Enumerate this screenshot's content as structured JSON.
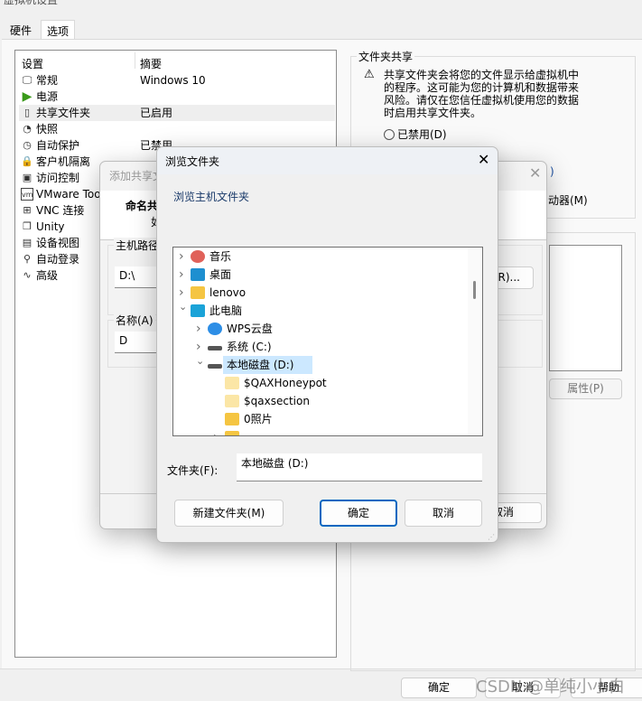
{
  "window": {
    "title": "虚拟机设置",
    "tabs": [
      "硬件",
      "选项"
    ],
    "active_tab": "选项"
  },
  "settings_list": {
    "col_setting": "设置",
    "col_summary": "摘要",
    "items": [
      {
        "label": "常规",
        "summary": "Windows 10",
        "icon": "monitor-icon"
      },
      {
        "label": "电源",
        "summary": "",
        "icon": "power-play-icon"
      },
      {
        "label": "共享文件夹",
        "summary": "已启用",
        "icon": "shared-folder-icon",
        "selected": true
      },
      {
        "label": "快照",
        "summary": "",
        "icon": "snapshot-icon"
      },
      {
        "label": "自动保护",
        "summary": "已禁用",
        "icon": "clock-icon"
      },
      {
        "label": "客户机隔离",
        "summary": "",
        "icon": "lock-icon"
      },
      {
        "label": "访问控制",
        "summary": "",
        "icon": "access-lock-icon"
      },
      {
        "label": "VMware Tools",
        "summary": "",
        "icon": "vm-icon"
      },
      {
        "label": "VNC 连接",
        "summary": "",
        "icon": "vnc-icon"
      },
      {
        "label": "Unity",
        "summary": "",
        "icon": "unity-icon"
      },
      {
        "label": "设备视图",
        "summary": "",
        "icon": "device-view-icon"
      },
      {
        "label": "自动登录",
        "summary": "",
        "icon": "autologin-icon"
      },
      {
        "label": "高级",
        "summary": "",
        "icon": "advanced-icon"
      }
    ]
  },
  "folder_sharing": {
    "title": "文件夹共享",
    "warning": "共享文件夹会将您的文件显示给虚拟机中的程序。这可能为您的计算机和数据带来风险。请仅在您信任虚拟机使用您的数据时启用共享文件夹。",
    "disabled_option": "已禁用(D)",
    "option2_partial": ")",
    "option3_partial": "动器(M)",
    "properties_button": "属性(P)"
  },
  "footer": {
    "ok": "确定",
    "cancel": "取消",
    "help": "帮助",
    "watermark": "CSDN @单纯小小白"
  },
  "wizard": {
    "title": "添加共享文件夹向导",
    "heading": "命名共享文件夹",
    "subheading": "如",
    "host_path_label": "主机路径",
    "host_path_value": "D:\\",
    "browse_button": "浏览(R)...",
    "name_label": "名称(A)",
    "name_value": "D",
    "cancel": "取消"
  },
  "browse": {
    "title": "浏览文件夹",
    "description": "浏览主机文件夹",
    "tree": [
      {
        "label": "音乐",
        "level": 0,
        "chevron": "right",
        "icon": "music-icon",
        "color": "#e0625a"
      },
      {
        "label": "桌面",
        "level": 0,
        "chevron": "right",
        "icon": "desktop-icon",
        "color": "#1e8fd0"
      },
      {
        "label": "lenovo",
        "level": 0,
        "chevron": "right",
        "icon": "folder-icon",
        "color": "#f5c542"
      },
      {
        "label": "此电脑",
        "level": 0,
        "chevron": "down",
        "icon": "computer-icon",
        "color": "#1ba3d8"
      },
      {
        "label": "WPS云盘",
        "level": 1,
        "chevron": "right",
        "icon": "cloud-icon",
        "color": "#2d8ee6"
      },
      {
        "label": "系统 (C:)",
        "level": 1,
        "chevron": "right",
        "icon": "system-drive-icon",
        "color": "#555"
      },
      {
        "label": "本地磁盘 (D:)",
        "level": 1,
        "chevron": "down",
        "icon": "drive-icon",
        "color": "#555",
        "selected": true
      },
      {
        "label": "$QAXHoneypot",
        "level": 2,
        "chevron": "",
        "icon": "folder-icon",
        "color": "#fbe6a6"
      },
      {
        "label": "$qaxsection",
        "level": 2,
        "chevron": "",
        "icon": "folder-icon",
        "color": "#fbe6a6"
      },
      {
        "label": "0照片",
        "level": 2,
        "chevron": "",
        "icon": "folder-icon",
        "color": "#f5c542"
      },
      {
        "label": "...",
        "level": 2,
        "chevron": "right",
        "icon": "folder-icon",
        "color": "#f5c542"
      }
    ],
    "folder_label": "文件夹(F):",
    "folder_value": "本地磁盘 (D:)",
    "new_folder": "新建文件夹(M)",
    "ok": "确定",
    "cancel": "取消",
    "selection_color": "#cce8ff",
    "accent": "#0067c0"
  }
}
